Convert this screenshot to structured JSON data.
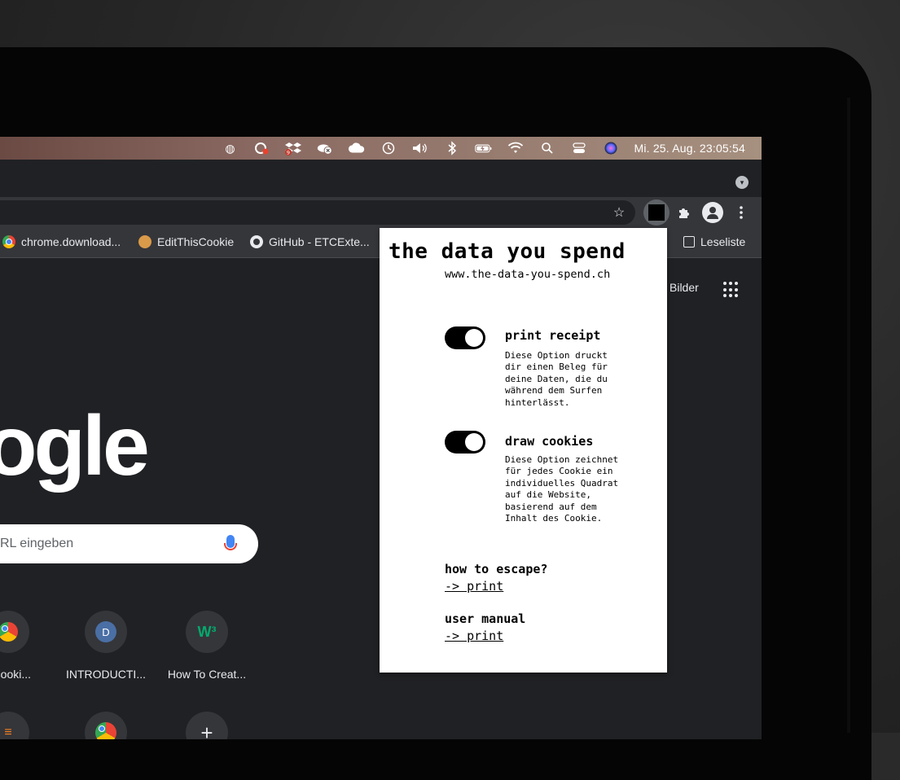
{
  "menubar": {
    "icons": [
      "user-lock-icon",
      "creative-cloud-icon",
      "dropbox-icon",
      "cloud-error-icon",
      "icloud-icon",
      "time-machine-icon",
      "volume-icon",
      "bluetooth-icon",
      "battery-icon",
      "wifi-icon",
      "spotlight-icon",
      "control-center-icon",
      "siri-icon"
    ],
    "badge": "9",
    "clock": "Mi. 25. Aug.  23:05:54"
  },
  "bookmarks": {
    "items": [
      {
        "label": "chrome.download...",
        "icon": "chrome-icon"
      },
      {
        "label": "EditThisCookie",
        "icon": "cookie-icon"
      },
      {
        "label": "GitHub - ETCExte...",
        "icon": "github-icon"
      }
    ],
    "reading_list": "Leseliste"
  },
  "google": {
    "logo_visible": "ogle",
    "bilder": "Bilder",
    "search_placeholder": "RL eingeben",
    "tiles": [
      {
        "label": "e.cooki...",
        "letter": ""
      },
      {
        "label": "INTRODUCTI...",
        "letter": "D"
      },
      {
        "label": "How To Creat...",
        "letter": "W³"
      }
    ],
    "add_shortcut": "+"
  },
  "popup": {
    "title": "the data you spend",
    "url": "www.the-data-you-spend.ch",
    "options": [
      {
        "title": "print receipt",
        "desc": "Diese Option druckt dir einen Beleg für deine Daten, die du während dem Surfen hinterlässt.",
        "on": true
      },
      {
        "title": "draw cookies",
        "desc": "Diese Option zeichnet für jedes Cookie ein individuelles Quadrat auf die Website, basierend auf dem Inhalt des Cookie.",
        "on": true
      }
    ],
    "sections": [
      {
        "title": "how to escape?",
        "link": "-> print"
      },
      {
        "title": "user manual",
        "link": "-> print"
      }
    ]
  }
}
